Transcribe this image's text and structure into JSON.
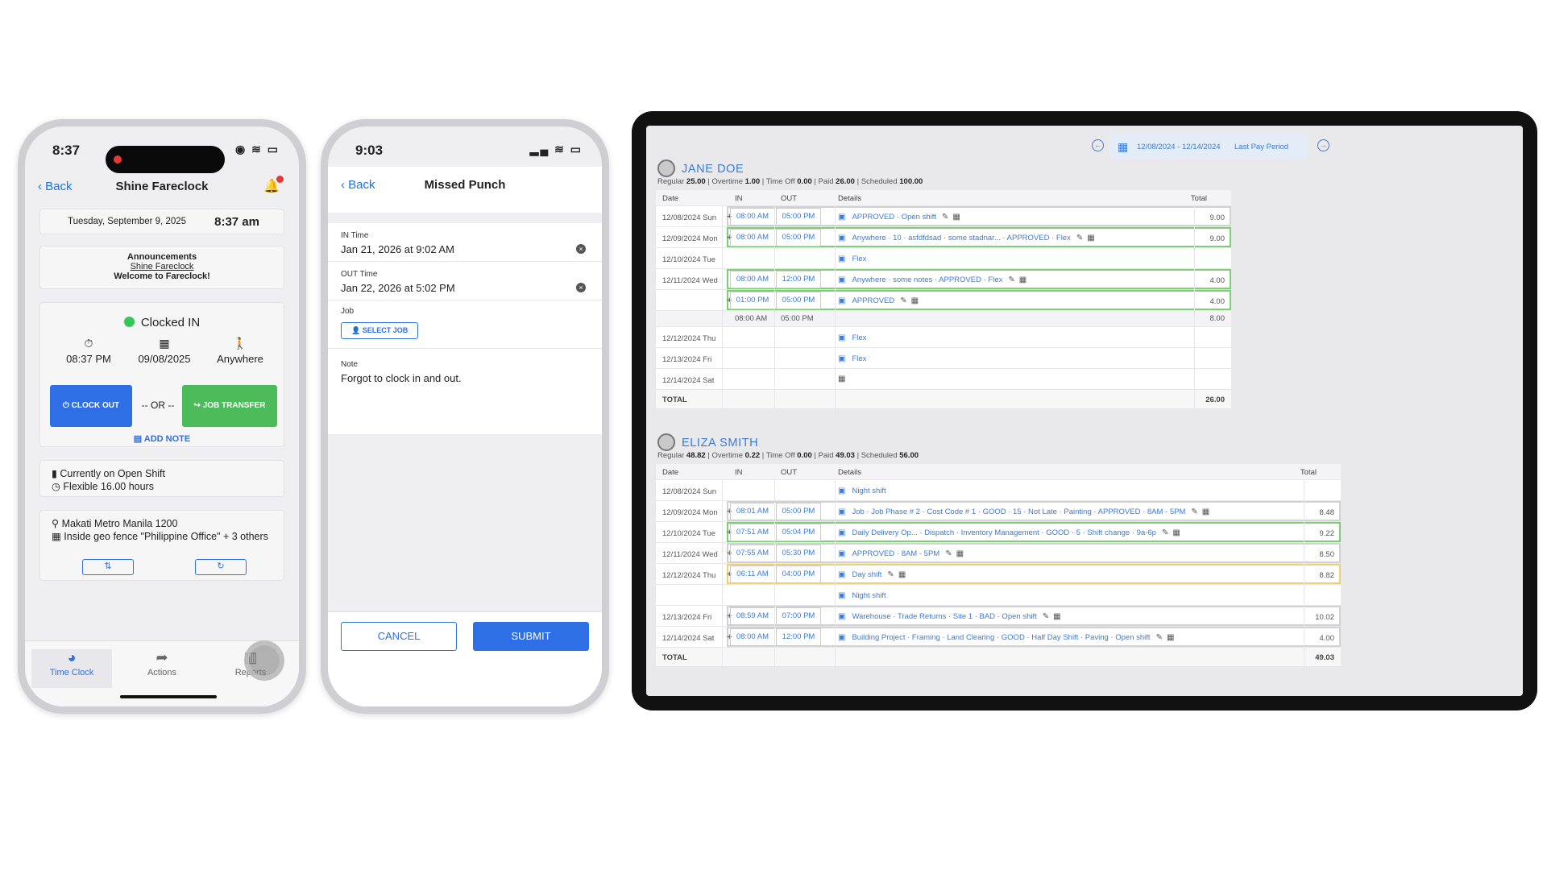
{
  "phone1": {
    "status_time": "8:37",
    "battery": "61",
    "back_label": "Back",
    "title": "Shine Fareclock",
    "date": "Tuesday, September 9, 2025",
    "time": "8:37 am",
    "announcements": {
      "heading": "Announcements",
      "company": "Shine Fareclock",
      "message": "Welcome to Fareclock!"
    },
    "status": "Clocked IN",
    "stats": [
      {
        "icon": "timer-icon",
        "value": "08:37 PM"
      },
      {
        "icon": "calendar-icon",
        "value": "09/08/2025"
      },
      {
        "icon": "person-walking-icon",
        "value": "Anywhere"
      }
    ],
    "clock_out_label": "CLOCK OUT",
    "or_label": "-- OR --",
    "job_transfer_label": "JOB TRANSFER",
    "add_note_label": "ADD NOTE",
    "shift_line1": "Currently on Open Shift",
    "shift_line2": "Flexible 16.00 hours",
    "location_line1": "Makati Metro Manila 1200",
    "location_line2": "Inside geo fence \"Philippine Office\" + 3 others",
    "tabs": [
      {
        "label": "Time Clock",
        "icon": "clock-icon",
        "active": true
      },
      {
        "label": "Actions",
        "icon": "share-arrow-icon",
        "active": false
      },
      {
        "label": "Reports",
        "icon": "bar-chart-icon",
        "active": false
      }
    ]
  },
  "phone2": {
    "status_time": "9:03",
    "battery": "74",
    "back_label": "Back",
    "title": "Missed Punch",
    "in_label": "IN Time",
    "in_value": "Jan 21, 2026 at 9:02 AM",
    "out_label": "OUT Time",
    "out_value": "Jan 22, 2026 at 5:02 PM",
    "job_label": "Job",
    "select_job_label": "SELECT JOB",
    "note_label": "Note",
    "note_value": "Forgot to clock in and out.",
    "cancel_label": "CANCEL",
    "submit_label": "SUBMIT"
  },
  "tablet": {
    "period_range": "12/08/2024 - 12/14/2024",
    "period_label": "Last Pay Period",
    "columns": {
      "date": "Date",
      "in": "IN",
      "out": "OUT",
      "details": "Details",
      "total": "Total"
    },
    "total_label": "TOTAL",
    "employees": [
      {
        "name": "JANE DOE",
        "summary": {
          "regular_label": "Regular",
          "regular": "25.00",
          "overtime_label": "Overtime",
          "overtime": "1.00",
          "timeoff_label": "Time Off",
          "timeoff": "0.00",
          "paid_label": "Paid",
          "paid": "26.00",
          "scheduled_label": "Scheduled",
          "scheduled": "100.00"
        },
        "total": "26.00",
        "rows": [
          {
            "date": "12/08/2024 Sun",
            "plus": "+",
            "in": "08:00 AM",
            "out": "05:00 PM",
            "details": "APPROVED · Open shift",
            "total": "9.00",
            "frame": "gray"
          },
          {
            "date": "12/09/2024 Mon",
            "plus": "+",
            "in": "08:00 AM",
            "out": "05:00 PM",
            "details": "Anywhere · 10 · asfdfdsad · some stadnar... · APPROVED · Flex",
            "total": "9.00",
            "frame": "green"
          },
          {
            "date": "12/10/2024 Tue",
            "plus": "",
            "in": "",
            "out": "",
            "details": "Flex",
            "total": "",
            "frame": ""
          },
          {
            "date": "12/11/2024 Wed",
            "plus": "",
            "in": "08:00 AM",
            "out": "12:00 PM",
            "details": "Anywhere · some notes · APPROVED · Flex",
            "total": "4.00",
            "frame": "green"
          },
          {
            "date": "",
            "plus": "+",
            "in": "01:00 PM",
            "out": "05:00 PM",
            "details": "APPROVED",
            "total": "4.00",
            "frame": "green"
          },
          {
            "date": "",
            "plus": "",
            "in": "08:00 AM",
            "out": "05:00 PM",
            "details": "",
            "total": "8.00",
            "frame": "sub"
          },
          {
            "date": "12/12/2024 Thu",
            "plus": "",
            "in": "",
            "out": "",
            "details": "Flex",
            "total": "",
            "frame": ""
          },
          {
            "date": "12/13/2024 Fri",
            "plus": "",
            "in": "",
            "out": "",
            "details": "Flex",
            "total": "",
            "frame": ""
          },
          {
            "date": "12/14/2024 Sat",
            "plus": "",
            "in": "",
            "out": "",
            "details": "",
            "total": "",
            "frame": ""
          }
        ]
      },
      {
        "name": "ELIZA SMITH",
        "summary": {
          "regular_label": "Regular",
          "regular": "48.82",
          "overtime_label": "Overtime",
          "overtime": "0.22",
          "timeoff_label": "Time Off",
          "timeoff": "0.00",
          "paid_label": "Paid",
          "paid": "49.03",
          "scheduled_label": "Scheduled",
          "scheduled": "56.00"
        },
        "total": "49.03",
        "rows": [
          {
            "date": "12/08/2024 Sun",
            "plus": "",
            "in": "",
            "out": "",
            "details": "Night shift",
            "total": "",
            "frame": ""
          },
          {
            "date": "12/09/2024 Mon",
            "plus": "+",
            "in": "08:01 AM",
            "out": "05:00 PM",
            "details": "Job · Job Phase # 2 · Cost Code # 1 · GOOD · 15 · Not Late · Painting · APPROVED · 8AM - 5PM",
            "total": "8.48",
            "frame": "gray"
          },
          {
            "date": "12/10/2024 Tue",
            "plus": "+",
            "in": "07:51 AM",
            "out": "05:04 PM",
            "details": "Daily Delivery Op... · Dispatch · Inventory Management · GOOD · 5 · Shift change · 9a-6p",
            "total": "9.22",
            "frame": "green"
          },
          {
            "date": "12/11/2024 Wed",
            "plus": "+",
            "in": "07:55 AM",
            "out": "05:30 PM",
            "details": "APPROVED · 8AM - 5PM",
            "total": "8.50",
            "frame": "gray"
          },
          {
            "date": "12/12/2024 Thu",
            "plus": "+",
            "in": "06:11 AM",
            "out": "04:00 PM",
            "details": "Day shift",
            "total": "8.82",
            "frame": "yellow"
          },
          {
            "date": "",
            "plus": "",
            "in": "",
            "out": "",
            "details": "Night shift",
            "total": "",
            "frame": ""
          },
          {
            "date": "12/13/2024 Fri",
            "plus": "+",
            "in": "08:59 AM",
            "out": "07:00 PM",
            "details": "Warehouse · Trade Returns · Site 1 · BAD · Open shift",
            "total": "10.02",
            "frame": "gray"
          },
          {
            "date": "12/14/2024 Sat",
            "plus": "+",
            "in": "08:00 AM",
            "out": "12:00 PM",
            "details": "Building Project · Framing · Land Clearing · GOOD · Half Day Shift · Paving · Open shift",
            "total": "4.00",
            "frame": "gray"
          }
        ]
      }
    ]
  }
}
